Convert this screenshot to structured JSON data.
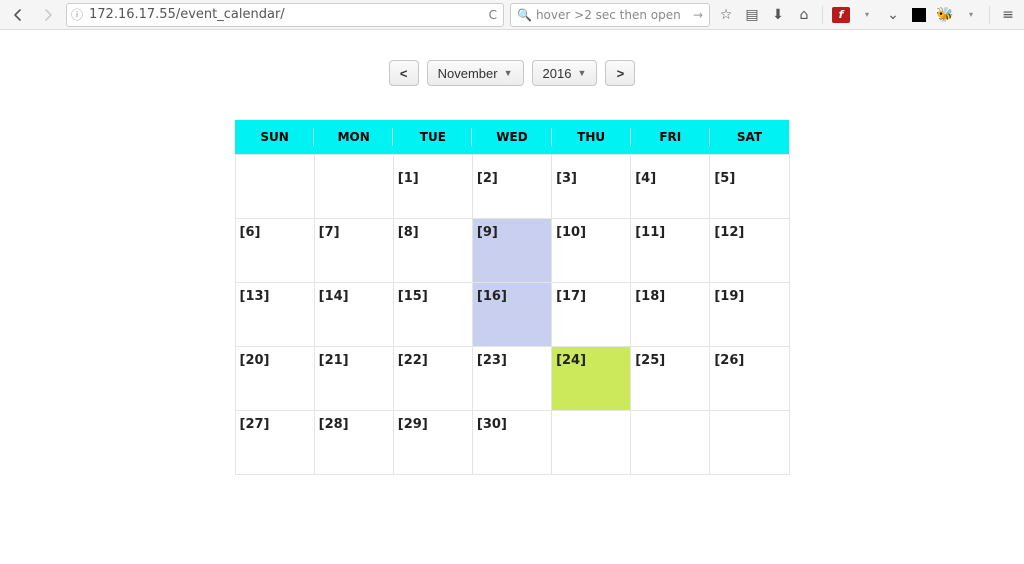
{
  "browser": {
    "url": "172.16.17.55/event_calendar/",
    "search_placeholder": "hover >2 sec then open"
  },
  "controls": {
    "prev": "<",
    "next": ">",
    "month": "November",
    "year": "2016"
  },
  "calendar": {
    "day_names": [
      "SUN",
      "MON",
      "TUE",
      "WED",
      "THU",
      "FRI",
      "SAT"
    ],
    "weeks": [
      [
        null,
        null,
        1,
        2,
        3,
        4,
        5
      ],
      [
        6,
        7,
        8,
        9,
        10,
        11,
        12
      ],
      [
        13,
        14,
        15,
        16,
        17,
        18,
        19
      ],
      [
        20,
        21,
        22,
        23,
        24,
        25,
        26
      ],
      [
        27,
        28,
        29,
        30,
        null,
        null,
        null
      ]
    ],
    "highlights": {
      "blue": [
        9,
        16
      ],
      "green": [
        24
      ]
    }
  }
}
